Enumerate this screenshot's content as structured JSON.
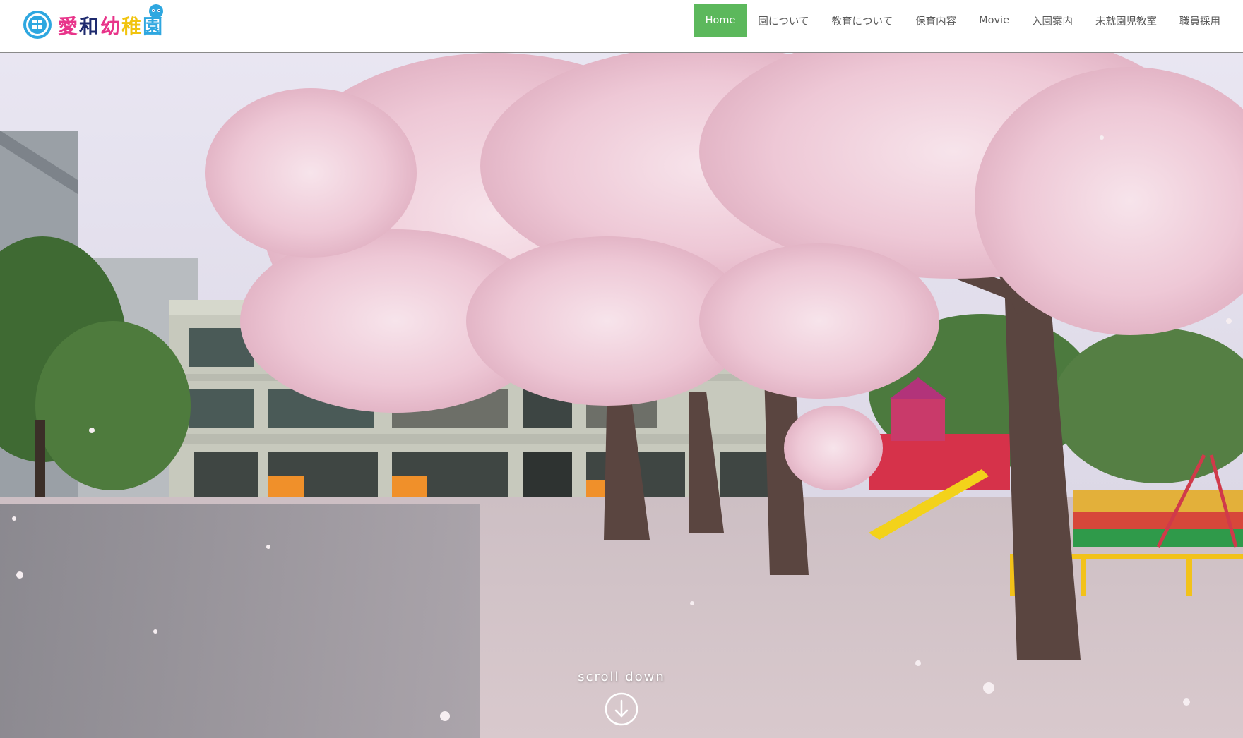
{
  "header": {
    "logo": {
      "text_chars": [
        "愛",
        "和",
        "幼",
        "稚",
        "園"
      ],
      "badge_icon": "kindergarten-badge-icon",
      "mascot_icon": "mascot-icon"
    },
    "nav": [
      {
        "label": "Home",
        "active": true
      },
      {
        "label": "園について",
        "active": false
      },
      {
        "label": "教育について",
        "active": false
      },
      {
        "label": "保育内容",
        "active": false
      },
      {
        "label": "Movie",
        "active": false
      },
      {
        "label": "入園案内",
        "active": false
      },
      {
        "label": "未就園児教室",
        "active": false
      },
      {
        "label": "職員採用",
        "active": false
      }
    ]
  },
  "hero": {
    "scroll_label": "scroll down",
    "scroll_icon": "arrow-down-circle-icon"
  },
  "colors": {
    "nav_active_bg": "#5cb85c",
    "nav_text": "#5a5a5a",
    "blossom": "#f3d6e0"
  }
}
